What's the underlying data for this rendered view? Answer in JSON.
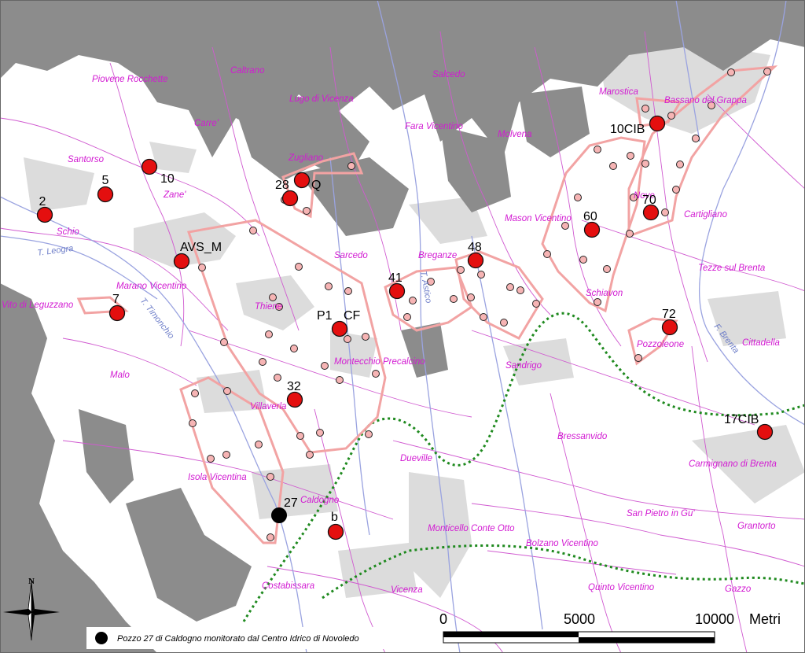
{
  "colors": {
    "hills": "#8c8c8c",
    "urban": "#d9d9d9",
    "municipal_border": "#d05ad0",
    "river": "#9aa3e0",
    "zone_outline": "#f2a3a3",
    "major_well": "#e40f0f",
    "minor_well": "#f6b4b4",
    "monitored_well": "#000000",
    "boundary_dotted": "#1f8a1f"
  },
  "towns": [
    {
      "id": "piovene",
      "label": "Piovene Rocchette"
    },
    {
      "id": "caltrano",
      "label": "Caltrano"
    },
    {
      "id": "salcedo",
      "label": "Salcedo"
    },
    {
      "id": "marostica",
      "label": "Marostica"
    },
    {
      "id": "lugo",
      "label": "Lugo di Vicenza"
    },
    {
      "id": "bassano",
      "label": "Bassano del Grappa"
    },
    {
      "id": "carre",
      "label": "Carre'"
    },
    {
      "id": "fara",
      "label": "Fara Vicentino"
    },
    {
      "id": "molvena",
      "label": "Molvena"
    },
    {
      "id": "santorso",
      "label": "Santorso"
    },
    {
      "id": "zugliano",
      "label": "Zugliano"
    },
    {
      "id": "zane",
      "label": "Zane'"
    },
    {
      "id": "nove",
      "label": "Nove"
    },
    {
      "id": "schio",
      "label": "Schio"
    },
    {
      "id": "mason",
      "label": "Mason Vicentino"
    },
    {
      "id": "cartigliano",
      "label": "Cartigliano"
    },
    {
      "id": "sarcedo",
      "label": "Sarcedo"
    },
    {
      "id": "breganze",
      "label": "Breganze"
    },
    {
      "id": "tezze",
      "label": "Tezze sul Brenta"
    },
    {
      "id": "marano",
      "label": "Marano Vicentino"
    },
    {
      "id": "schiavon",
      "label": "Schiavon"
    },
    {
      "id": "villaverla_lg",
      "label": "Vito di Leguzzano"
    },
    {
      "id": "thiene",
      "label": "Thiene"
    },
    {
      "id": "pozzoleone",
      "label": "Pozzoleone"
    },
    {
      "id": "cittadella",
      "label": "Cittadella"
    },
    {
      "id": "montecchio",
      "label": "Montecchio Precalcino"
    },
    {
      "id": "sandrigo",
      "label": "Sandrigo"
    },
    {
      "id": "malo",
      "label": "Malo"
    },
    {
      "id": "villaverla",
      "label": "Villaverla"
    },
    {
      "id": "bressanvido",
      "label": "Bressanvido"
    },
    {
      "id": "dueville",
      "label": "Dueville"
    },
    {
      "id": "carmignano",
      "label": "Carmignano di Brenta"
    },
    {
      "id": "isola",
      "label": "Isola Vicentina"
    },
    {
      "id": "caldogno",
      "label": "Caldogno"
    },
    {
      "id": "sanpietro",
      "label": "San Pietro in Gu'"
    },
    {
      "id": "grantorto",
      "label": "Grantorto"
    },
    {
      "id": "monticello",
      "label": "Monticello Conte Otto"
    },
    {
      "id": "bolzano",
      "label": "Bolzano Vicentino"
    },
    {
      "id": "costabissara",
      "label": "Costabissara"
    },
    {
      "id": "vicenza",
      "label": "Vicenza"
    },
    {
      "id": "quinto",
      "label": "Quinto Vicentino"
    },
    {
      "id": "gazzo",
      "label": "Gazzo"
    }
  ],
  "rivers": [
    {
      "id": "leogra",
      "label": "T. Leogra"
    },
    {
      "id": "timonchio",
      "label": "T. Timonchio"
    },
    {
      "id": "astico",
      "label": "T. Astico"
    },
    {
      "id": "brenta",
      "label": "F. Brenta"
    }
  ],
  "wells": [
    {
      "id": "w2",
      "label": "2"
    },
    {
      "id": "w5",
      "label": "5"
    },
    {
      "id": "w10",
      "label": "10"
    },
    {
      "id": "w28",
      "label": "28"
    },
    {
      "id": "wQ",
      "label": "Q"
    },
    {
      "id": "w10cib",
      "label": "10CIB"
    },
    {
      "id": "w70",
      "label": "70"
    },
    {
      "id": "w60",
      "label": "60"
    },
    {
      "id": "wavs",
      "label": "AVS_M"
    },
    {
      "id": "w48",
      "label": "48"
    },
    {
      "id": "w41",
      "label": "41"
    },
    {
      "id": "w7",
      "label": "7"
    },
    {
      "id": "wp1",
      "label": "P1"
    },
    {
      "id": "wcf",
      "label": "CF"
    },
    {
      "id": "w72",
      "label": "72"
    },
    {
      "id": "w32",
      "label": "32"
    },
    {
      "id": "w17cib",
      "label": "17CIB"
    },
    {
      "id": "w27",
      "label": "27"
    },
    {
      "id": "wb",
      "label": "b"
    }
  ],
  "scale_bar": {
    "tick_0": "0",
    "tick_5000": "5000",
    "tick_10000": "10000",
    "unit": "Metri"
  },
  "legend": {
    "text": "Pozzo 27 di Caldogno monitorato dal Centro Idrico di Novoledo"
  },
  "north_arrow": {
    "label": "N"
  }
}
